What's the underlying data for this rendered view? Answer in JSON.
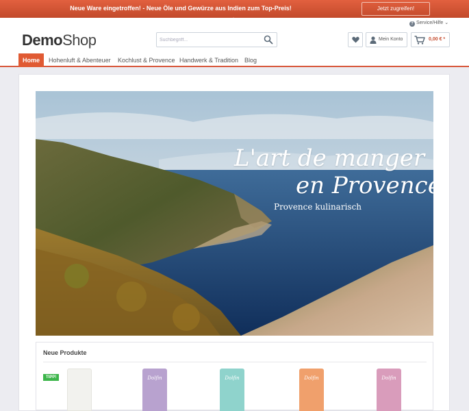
{
  "promo": {
    "text": "Neue Ware eingetroffen! - Neue Öle und Gewürze aus Indien zum Top-Preis!",
    "button": "Jetzt zugreifen!"
  },
  "header": {
    "service": "Service/Hilfe",
    "logo_bold": "Demo",
    "logo_light": "Shop",
    "search_placeholder": "Suchbegriff...",
    "account_label": "Mein Konto",
    "cart_total": "0,00 € *"
  },
  "nav": {
    "items": [
      "Home",
      "Hohenluft & Abenteuer",
      "Kochlust & Provence",
      "Handwerk & Tradition",
      "Blog"
    ]
  },
  "hero": {
    "title_line1": "L'art de manger",
    "title_line2": "en Provence",
    "subtitle": "Provence kulinarisch"
  },
  "products": {
    "title": "Neue Produkte",
    "badge": "TIPP!",
    "items": [
      {
        "label": "",
        "color": "#f2f2ee"
      },
      {
        "label": "Dolfin",
        "color": "#b8a2cf"
      },
      {
        "label": "Dolfin",
        "color": "#8fd3cc"
      },
      {
        "label": "Dolfin",
        "color": "#f0a06c"
      },
      {
        "label": "Dolfin",
        "color": "#d99cbb"
      }
    ]
  },
  "colors": {
    "accent": "#e05a33",
    "badge": "#3cb54a"
  }
}
